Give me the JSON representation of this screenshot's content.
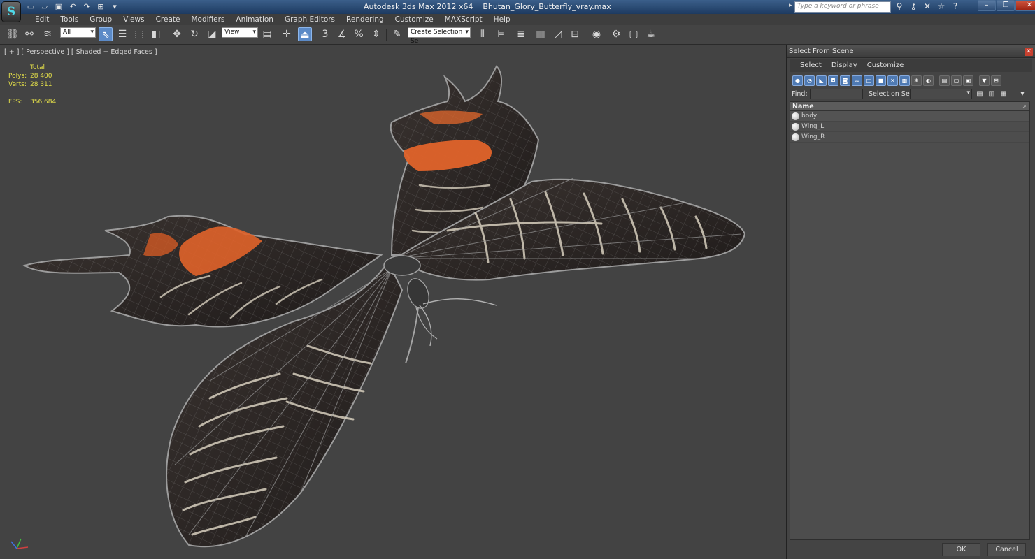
{
  "titlebar": {
    "app_title": "Autodesk 3ds Max  2012 x64",
    "file_name": "Bhutan_Glory_Butterfly_vray.max",
    "search_placeholder": "Type a keyword or phrase",
    "logo_glyph": "S"
  },
  "menu": {
    "items": [
      "Edit",
      "Tools",
      "Group",
      "Views",
      "Create",
      "Modifiers",
      "Animation",
      "Graph Editors",
      "Rendering",
      "Customize",
      "MAXScript",
      "Help"
    ]
  },
  "toolbar": {
    "filter_value": "All",
    "coord_system_value": "View",
    "selection_set_value": "Create Selection Se",
    "snap_3_label": "3",
    "percent_snap_label": "%"
  },
  "viewport": {
    "label": "[ + ] [ Perspective ] [ Shaded + Edged Faces ]",
    "stats": {
      "total_label": "Total",
      "polys_label": "Polys:",
      "polys_value": "28 400",
      "verts_label": "Verts:",
      "verts_value": "28 311",
      "fps_label": "FPS:",
      "fps_value": "356,684"
    },
    "colors": {
      "background": "#434343",
      "wing_dark": "#2a2523",
      "wing_orange": "#e0632a",
      "stripe": "#d9d2c2",
      "wire": "#a8a8a8",
      "stats_text": "#e5e049"
    }
  },
  "scene_panel": {
    "title": "Select From Scene",
    "tabs": [
      "Select",
      "Display",
      "Customize"
    ],
    "find_label": "Find:",
    "find_value": "",
    "selection_set_label": "Selection Set:",
    "selection_set_value": "",
    "column_header": "Name",
    "objects": [
      {
        "name": "body"
      },
      {
        "name": "Wing_L"
      },
      {
        "name": "Wing_R"
      }
    ],
    "ok_label": "OK",
    "cancel_label": "Cancel"
  }
}
